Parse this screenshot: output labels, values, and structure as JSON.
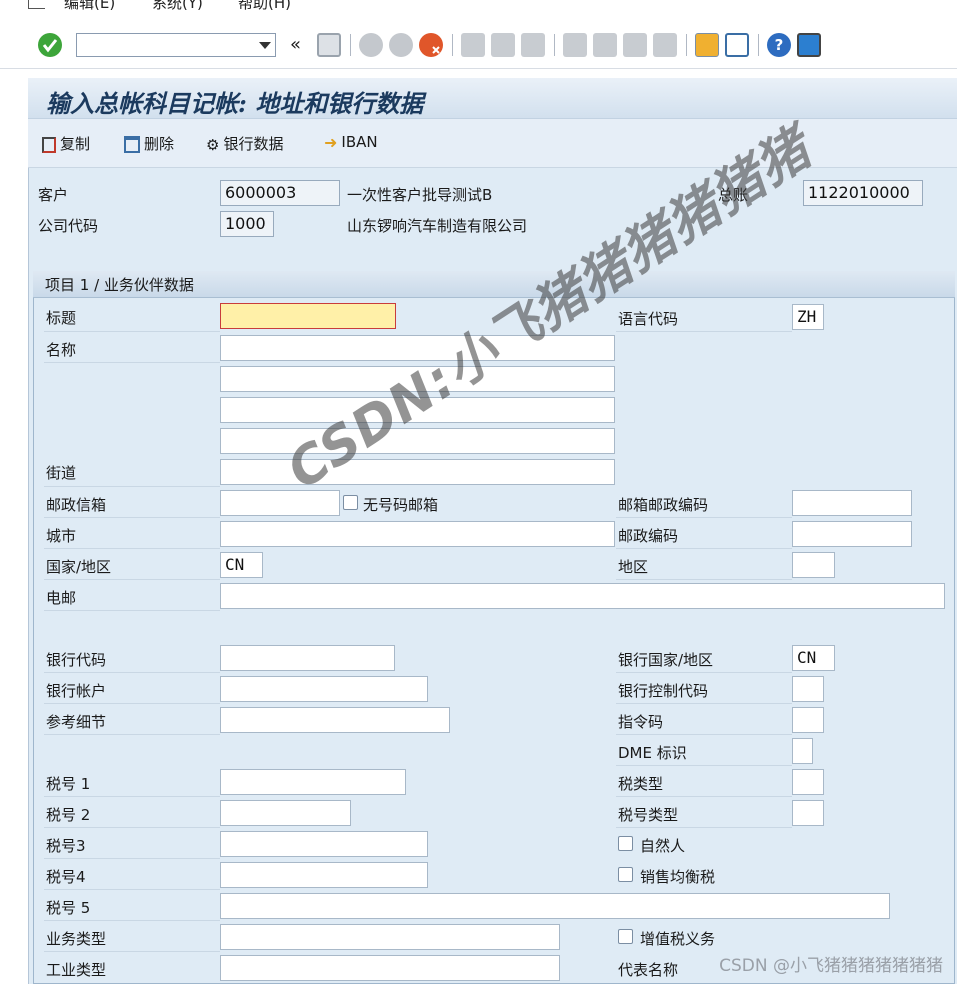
{
  "menu": {
    "edit": "编辑(E)",
    "system": "系统(Y)",
    "help": "帮助(H)"
  },
  "toolbar": {
    "command_value": "",
    "history_glyph": "«"
  },
  "title": "输入总帐科目记帐: 地址和银行数据",
  "app_toolbar": {
    "copy": "复制",
    "delete": "删除",
    "bank": "银行数据",
    "iban": "IBAN"
  },
  "header": {
    "customer_label": "客户",
    "customer_value": "6000003",
    "customer_desc": "一次性客户批导测试B",
    "gl_label": "总账",
    "gl_value": "1122010000",
    "company_label": "公司代码",
    "company_value": "1000",
    "company_desc": "山东锣响汽车制造有限公司"
  },
  "group": {
    "title": "项目 1 / 业务伙伴数据",
    "labels": {
      "title": "标题",
      "name": "名称",
      "street": "街道",
      "pobox": "邮政信箱",
      "no_number": "无号码邮箱",
      "city": "城市",
      "country": "国家/地区",
      "email": "电邮",
      "bank_key": "银行代码",
      "bank_account": "银行帐户",
      "reference": "参考细节",
      "tax1": "税号 1",
      "tax2": "税号 2",
      "tax3": "税号3",
      "tax4": "税号4",
      "tax5": "税号 5",
      "biz_type": "业务类型",
      "ind_type": "工业类型",
      "language": "语言代码",
      "pobox_postal": "邮箱邮政编码",
      "postal": "邮政编码",
      "region": "地区",
      "bank_country": "银行国家/地区",
      "bank_ctrl": "银行控制代码",
      "instruction": "指令码",
      "dme": "DME 标识",
      "tax_type": "税类型",
      "tax_num_type": "税号类型",
      "natural_person": "自然人",
      "sales_eq_tax": "销售均衡税",
      "vat_liable": "增值税义务",
      "rep_name": "代表名称"
    },
    "values": {
      "language": "ZH",
      "country": "CN",
      "bank_country": "CN"
    }
  },
  "watermark": "CSDN:小飞猪猪猪猪猪猪",
  "csdn_footer": "CSDN @小飞猪猪猪猪猪猪猪",
  "colors": {
    "frame_bg": "#dfebf5",
    "title_text": "#1b3a5e",
    "focus_field": "#fff0a8"
  }
}
